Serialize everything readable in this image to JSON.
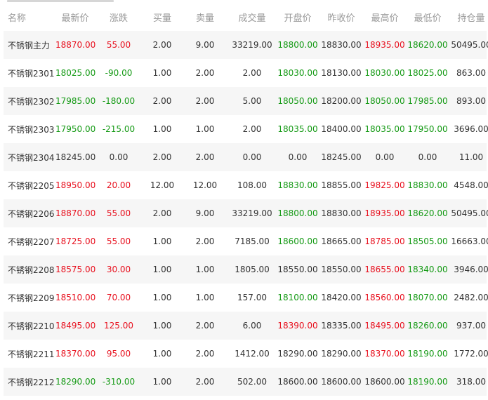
{
  "columns": [
    "名称",
    "最新价",
    "涨跌",
    "买量",
    "卖量",
    "成交量",
    "开盘价",
    "昨收价",
    "最高价",
    "最低价",
    "持仓量"
  ],
  "colors": {
    "up": "#e8101e",
    "down": "#159a15",
    "flat": "#333333",
    "header": "#999999"
  },
  "rows": [
    {
      "name": "不锈钢主力",
      "cells": [
        "18870.00",
        "55.00",
        "2.00",
        "9.00",
        "33219.00",
        "18800.00",
        "18830.00",
        "18935.00",
        "18620.00",
        "50495.00"
      ],
      "tones": [
        "up",
        "up",
        "flat",
        "flat",
        "flat",
        "down",
        "flat",
        "up",
        "down",
        "flat"
      ]
    },
    {
      "name": "不锈钢2301",
      "cells": [
        "18025.00",
        "-90.00",
        "1.00",
        "2.00",
        "2.00",
        "18030.00",
        "18130.00",
        "18030.00",
        "18025.00",
        "863.00"
      ],
      "tones": [
        "down",
        "down",
        "flat",
        "flat",
        "flat",
        "down",
        "flat",
        "down",
        "down",
        "flat"
      ]
    },
    {
      "name": "不锈钢2302",
      "cells": [
        "17985.00",
        "-180.00",
        "2.00",
        "2.00",
        "5.00",
        "18050.00",
        "18200.00",
        "18050.00",
        "17985.00",
        "893.00"
      ],
      "tones": [
        "down",
        "down",
        "flat",
        "flat",
        "flat",
        "down",
        "flat",
        "down",
        "down",
        "flat"
      ]
    },
    {
      "name": "不锈钢2303",
      "cells": [
        "17950.00",
        "-215.00",
        "1.00",
        "1.00",
        "2.00",
        "18035.00",
        "18400.00",
        "18035.00",
        "17950.00",
        "3696.00"
      ],
      "tones": [
        "down",
        "down",
        "flat",
        "flat",
        "flat",
        "down",
        "flat",
        "down",
        "down",
        "flat"
      ]
    },
    {
      "name": "不锈钢2304",
      "cells": [
        "18245.00",
        "0.00",
        "2.00",
        "2.00",
        "0.00",
        "0.00",
        "18245.00",
        "0.00",
        "0.00",
        "11.00"
      ],
      "tones": [
        "flat",
        "flat",
        "flat",
        "flat",
        "flat",
        "flat",
        "flat",
        "flat",
        "flat",
        "flat"
      ]
    },
    {
      "name": "不锈钢2205",
      "cells": [
        "18950.00",
        "20.00",
        "12.00",
        "12.00",
        "108.00",
        "18830.00",
        "18855.00",
        "19825.00",
        "18830.00",
        "4548.00"
      ],
      "tones": [
        "up",
        "up",
        "flat",
        "flat",
        "flat",
        "down",
        "flat",
        "up",
        "down",
        "flat"
      ]
    },
    {
      "name": "不锈钢2206",
      "cells": [
        "18870.00",
        "55.00",
        "2.00",
        "9.00",
        "33219.00",
        "18800.00",
        "18830.00",
        "18935.00",
        "18620.00",
        "50495.00"
      ],
      "tones": [
        "up",
        "up",
        "flat",
        "flat",
        "flat",
        "down",
        "flat",
        "up",
        "down",
        "flat"
      ]
    },
    {
      "name": "不锈钢2207",
      "cells": [
        "18725.00",
        "55.00",
        "1.00",
        "2.00",
        "7185.00",
        "18600.00",
        "18665.00",
        "18785.00",
        "18505.00",
        "16663.00"
      ],
      "tones": [
        "up",
        "up",
        "flat",
        "flat",
        "flat",
        "down",
        "flat",
        "up",
        "down",
        "flat"
      ]
    },
    {
      "name": "不锈钢2208",
      "cells": [
        "18575.00",
        "30.00",
        "1.00",
        "1.00",
        "1805.00",
        "18550.00",
        "18550.00",
        "18655.00",
        "18340.00",
        "3946.00"
      ],
      "tones": [
        "up",
        "up",
        "flat",
        "flat",
        "flat",
        "flat",
        "flat",
        "up",
        "down",
        "flat"
      ]
    },
    {
      "name": "不锈钢2209",
      "cells": [
        "18510.00",
        "70.00",
        "1.00",
        "1.00",
        "157.00",
        "18100.00",
        "18420.00",
        "18560.00",
        "18070.00",
        "2482.00"
      ],
      "tones": [
        "up",
        "up",
        "flat",
        "flat",
        "flat",
        "down",
        "flat",
        "up",
        "down",
        "flat"
      ]
    },
    {
      "name": "不锈钢2210",
      "cells": [
        "18495.00",
        "125.00",
        "1.00",
        "2.00",
        "6.00",
        "18390.00",
        "18335.00",
        "18495.00",
        "18260.00",
        "937.00"
      ],
      "tones": [
        "up",
        "up",
        "flat",
        "flat",
        "flat",
        "up",
        "flat",
        "up",
        "down",
        "flat"
      ]
    },
    {
      "name": "不锈钢2211",
      "cells": [
        "18370.00",
        "95.00",
        "1.00",
        "2.00",
        "1412.00",
        "18290.00",
        "18290.00",
        "18370.00",
        "18190.00",
        "1772.00"
      ],
      "tones": [
        "up",
        "up",
        "flat",
        "flat",
        "flat",
        "flat",
        "flat",
        "up",
        "down",
        "flat"
      ]
    },
    {
      "name": "不锈钢2212",
      "cells": [
        "18290.00",
        "-310.00",
        "1.00",
        "2.00",
        "502.00",
        "18600.00",
        "18600.00",
        "18600.00",
        "18190.00",
        "318.00"
      ],
      "tones": [
        "down",
        "down",
        "flat",
        "flat",
        "flat",
        "flat",
        "flat",
        "flat",
        "down",
        "flat"
      ]
    }
  ]
}
